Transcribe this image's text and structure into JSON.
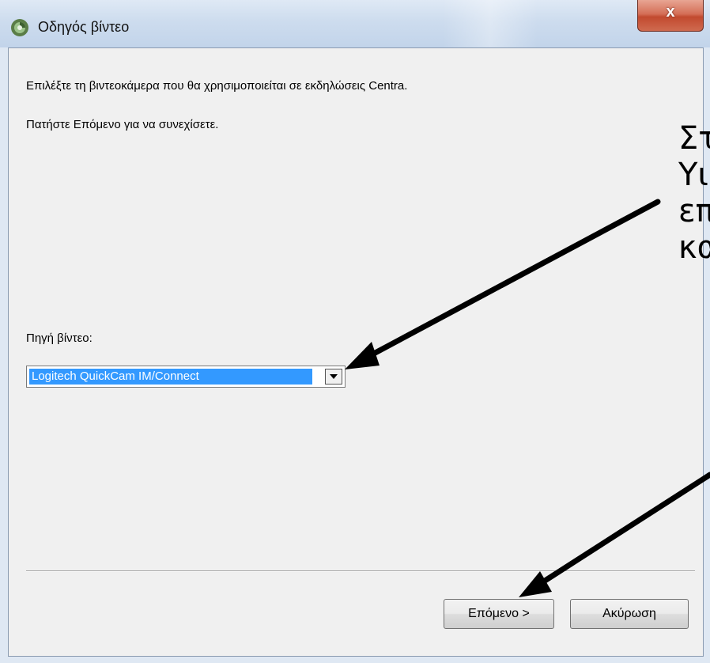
{
  "window": {
    "title": "Οδηγός βίντεο",
    "close_label": "x"
  },
  "content": {
    "intro": "Επιλέξτε τη βιντεοκάμερα που θα χρησιμοποιείται σε εκδηλώσεις Centra.",
    "instruction": "Πατήστε Επόμενο για να συνεχίσετε.",
    "source_label": "Πηγή βίντεο:",
    "source_value": "Logitech QuickCam IM/Connect"
  },
  "buttons": {
    "next": "Επόμενο >",
    "cancel": "Ακύρωση"
  },
  "annotation": {
    "lines": [
      "Στ",
      "Υι",
      "επ",
      "κα"
    ]
  }
}
